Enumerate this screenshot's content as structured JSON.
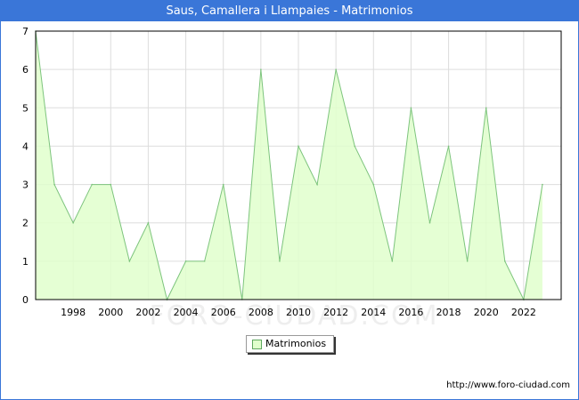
{
  "window": {
    "title": "Saus, Camallera i Llampaies - Matrimonios"
  },
  "chart_data": {
    "type": "area",
    "title": "Saus, Camallera i Llampaies - Matrimonios",
    "x": [
      1996,
      1997,
      1998,
      1999,
      2000,
      2001,
      2002,
      2003,
      2004,
      2005,
      2006,
      2007,
      2008,
      2009,
      2010,
      2011,
      2012,
      2013,
      2014,
      2015,
      2016,
      2017,
      2018,
      2019,
      2020,
      2021,
      2022,
      2023
    ],
    "series": [
      {
        "name": "Matrimonios",
        "values": [
          7,
          3,
          2,
          3,
          3,
          1,
          2,
          0,
          1,
          1,
          3,
          0,
          6,
          1,
          4,
          3,
          6,
          4,
          3,
          1,
          5,
          2,
          4,
          1,
          5,
          1,
          0,
          3
        ]
      }
    ],
    "x_tick_labels": [
      "1998",
      "2000",
      "2002",
      "2004",
      "2006",
      "2008",
      "2010",
      "2012",
      "2014",
      "2016",
      "2018",
      "2020",
      "2022"
    ],
    "y_tick_labels": [
      "0",
      "1",
      "2",
      "3",
      "4",
      "5",
      "6",
      "7"
    ],
    "xlim": [
      1996,
      2024
    ],
    "ylim": [
      0,
      7
    ],
    "grid": true,
    "legend_position": "bottom-center",
    "colors": {
      "fill": "#e0ffcc",
      "line": "#7dc47d",
      "title_bar": "#3a76d8",
      "grid": "#dddddd"
    }
  },
  "legend": {
    "label": "Matrimonios"
  },
  "watermark": "FORO-CIUDAD.COM",
  "footer": {
    "url": "http://www.foro-ciudad.com"
  }
}
